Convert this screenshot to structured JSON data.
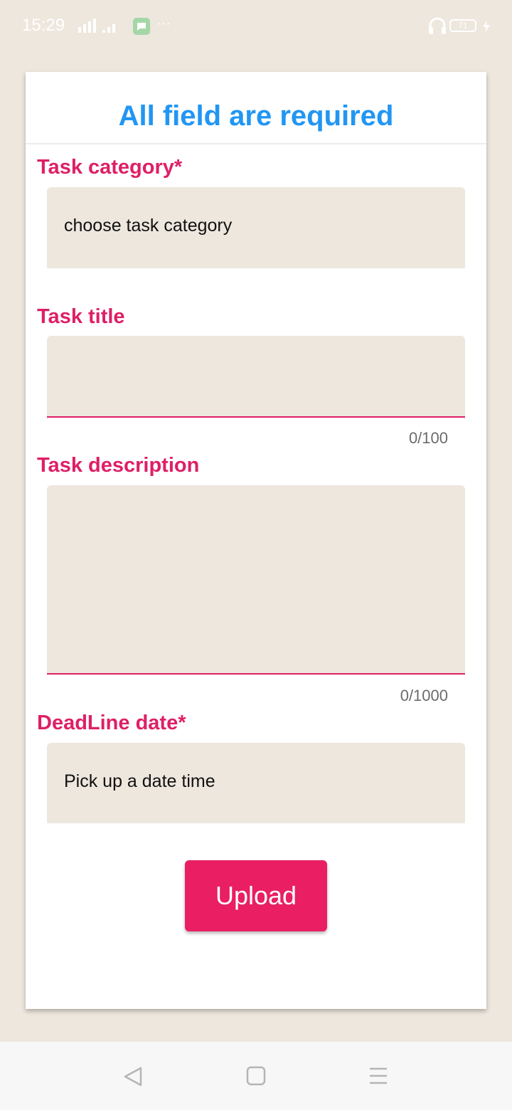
{
  "status_bar": {
    "time": "15:29",
    "battery": "71",
    "icons": [
      "signal-icon",
      "message-icon",
      "more-dots-icon",
      "headset-icon",
      "battery-icon",
      "charging-icon"
    ],
    "dots": "···"
  },
  "form": {
    "title": "All field are required",
    "fields": {
      "category": {
        "label": "Task category*",
        "value": "choose task category"
      },
      "title": {
        "label": "Task title",
        "value": "",
        "counter": "0/100"
      },
      "description": {
        "label": "Task description",
        "value": "",
        "counter": "0/1000"
      },
      "deadline": {
        "label": "DeadLine date*",
        "value": "Pick up a date time"
      }
    },
    "upload_label": "Upload"
  },
  "nav_bar": {
    "icons": [
      "back-icon",
      "home-icon",
      "menu-icon"
    ]
  },
  "colors": {
    "background": "#EDE7DD",
    "title": "#2196F3",
    "label": "#DE1F65",
    "button": "#E91E63",
    "field_fill": "#EDE7DD"
  }
}
